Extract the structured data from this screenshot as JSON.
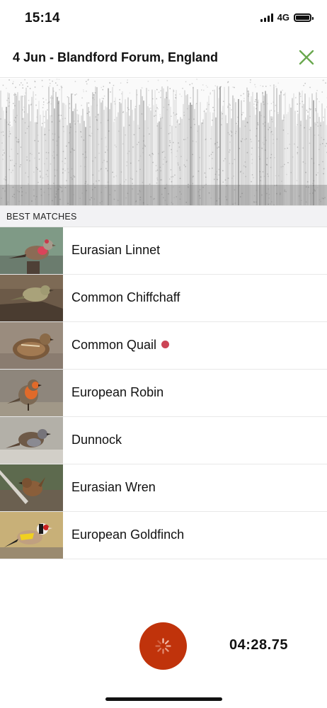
{
  "status_bar": {
    "time": "15:14",
    "network": "4G"
  },
  "header": {
    "title": "4 Jun - Blandford Forum, England"
  },
  "section": {
    "label": "BEST MATCHES"
  },
  "matches": [
    {
      "name": "Eurasian Linnet",
      "highlighted": false
    },
    {
      "name": "Common Chiffchaff",
      "highlighted": false
    },
    {
      "name": "Common Quail",
      "highlighted": true
    },
    {
      "name": "European Robin",
      "highlighted": false
    },
    {
      "name": "Dunnock",
      "highlighted": false
    },
    {
      "name": "Eurasian Wren",
      "highlighted": false
    },
    {
      "name": "European Goldfinch",
      "highlighted": false
    }
  ],
  "recorder": {
    "elapsed": "04:28.75"
  },
  "colors": {
    "accent_green": "#6aa84f",
    "record_red": "#c0330b",
    "highlight_dot": "#cc4455"
  },
  "icons": {
    "close": "close-icon",
    "record": "spinner-icon"
  }
}
